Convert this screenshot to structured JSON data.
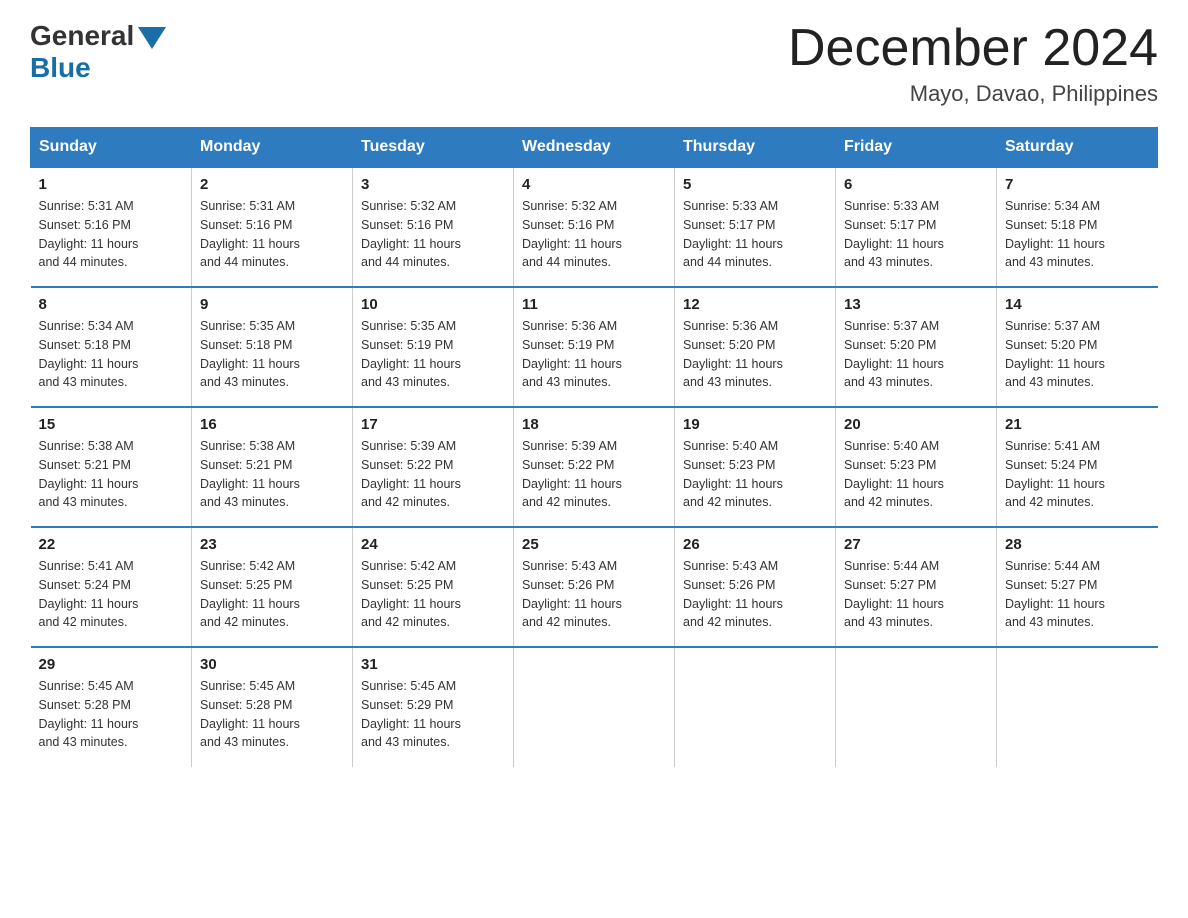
{
  "logo": {
    "general": "General",
    "blue": "Blue"
  },
  "header": {
    "title": "December 2024",
    "subtitle": "Mayo, Davao, Philippines"
  },
  "weekdays": [
    "Sunday",
    "Monday",
    "Tuesday",
    "Wednesday",
    "Thursday",
    "Friday",
    "Saturday"
  ],
  "weeks": [
    [
      {
        "day": "1",
        "sunrise": "5:31 AM",
        "sunset": "5:16 PM",
        "daylight": "11 hours and 44 minutes."
      },
      {
        "day": "2",
        "sunrise": "5:31 AM",
        "sunset": "5:16 PM",
        "daylight": "11 hours and 44 minutes."
      },
      {
        "day": "3",
        "sunrise": "5:32 AM",
        "sunset": "5:16 PM",
        "daylight": "11 hours and 44 minutes."
      },
      {
        "day": "4",
        "sunrise": "5:32 AM",
        "sunset": "5:16 PM",
        "daylight": "11 hours and 44 minutes."
      },
      {
        "day": "5",
        "sunrise": "5:33 AM",
        "sunset": "5:17 PM",
        "daylight": "11 hours and 44 minutes."
      },
      {
        "day": "6",
        "sunrise": "5:33 AM",
        "sunset": "5:17 PM",
        "daylight": "11 hours and 43 minutes."
      },
      {
        "day": "7",
        "sunrise": "5:34 AM",
        "sunset": "5:18 PM",
        "daylight": "11 hours and 43 minutes."
      }
    ],
    [
      {
        "day": "8",
        "sunrise": "5:34 AM",
        "sunset": "5:18 PM",
        "daylight": "11 hours and 43 minutes."
      },
      {
        "day": "9",
        "sunrise": "5:35 AM",
        "sunset": "5:18 PM",
        "daylight": "11 hours and 43 minutes."
      },
      {
        "day": "10",
        "sunrise": "5:35 AM",
        "sunset": "5:19 PM",
        "daylight": "11 hours and 43 minutes."
      },
      {
        "day": "11",
        "sunrise": "5:36 AM",
        "sunset": "5:19 PM",
        "daylight": "11 hours and 43 minutes."
      },
      {
        "day": "12",
        "sunrise": "5:36 AM",
        "sunset": "5:20 PM",
        "daylight": "11 hours and 43 minutes."
      },
      {
        "day": "13",
        "sunrise": "5:37 AM",
        "sunset": "5:20 PM",
        "daylight": "11 hours and 43 minutes."
      },
      {
        "day": "14",
        "sunrise": "5:37 AM",
        "sunset": "5:20 PM",
        "daylight": "11 hours and 43 minutes."
      }
    ],
    [
      {
        "day": "15",
        "sunrise": "5:38 AM",
        "sunset": "5:21 PM",
        "daylight": "11 hours and 43 minutes."
      },
      {
        "day": "16",
        "sunrise": "5:38 AM",
        "sunset": "5:21 PM",
        "daylight": "11 hours and 43 minutes."
      },
      {
        "day": "17",
        "sunrise": "5:39 AM",
        "sunset": "5:22 PM",
        "daylight": "11 hours and 42 minutes."
      },
      {
        "day": "18",
        "sunrise": "5:39 AM",
        "sunset": "5:22 PM",
        "daylight": "11 hours and 42 minutes."
      },
      {
        "day": "19",
        "sunrise": "5:40 AM",
        "sunset": "5:23 PM",
        "daylight": "11 hours and 42 minutes."
      },
      {
        "day": "20",
        "sunrise": "5:40 AM",
        "sunset": "5:23 PM",
        "daylight": "11 hours and 42 minutes."
      },
      {
        "day": "21",
        "sunrise": "5:41 AM",
        "sunset": "5:24 PM",
        "daylight": "11 hours and 42 minutes."
      }
    ],
    [
      {
        "day": "22",
        "sunrise": "5:41 AM",
        "sunset": "5:24 PM",
        "daylight": "11 hours and 42 minutes."
      },
      {
        "day": "23",
        "sunrise": "5:42 AM",
        "sunset": "5:25 PM",
        "daylight": "11 hours and 42 minutes."
      },
      {
        "day": "24",
        "sunrise": "5:42 AM",
        "sunset": "5:25 PM",
        "daylight": "11 hours and 42 minutes."
      },
      {
        "day": "25",
        "sunrise": "5:43 AM",
        "sunset": "5:26 PM",
        "daylight": "11 hours and 42 minutes."
      },
      {
        "day": "26",
        "sunrise": "5:43 AM",
        "sunset": "5:26 PM",
        "daylight": "11 hours and 42 minutes."
      },
      {
        "day": "27",
        "sunrise": "5:44 AM",
        "sunset": "5:27 PM",
        "daylight": "11 hours and 43 minutes."
      },
      {
        "day": "28",
        "sunrise": "5:44 AM",
        "sunset": "5:27 PM",
        "daylight": "11 hours and 43 minutes."
      }
    ],
    [
      {
        "day": "29",
        "sunrise": "5:45 AM",
        "sunset": "5:28 PM",
        "daylight": "11 hours and 43 minutes."
      },
      {
        "day": "30",
        "sunrise": "5:45 AM",
        "sunset": "5:28 PM",
        "daylight": "11 hours and 43 minutes."
      },
      {
        "day": "31",
        "sunrise": "5:45 AM",
        "sunset": "5:29 PM",
        "daylight": "11 hours and 43 minutes."
      },
      null,
      null,
      null,
      null
    ]
  ],
  "labels": {
    "sunrise": "Sunrise:",
    "sunset": "Sunset:",
    "daylight": "Daylight:"
  }
}
